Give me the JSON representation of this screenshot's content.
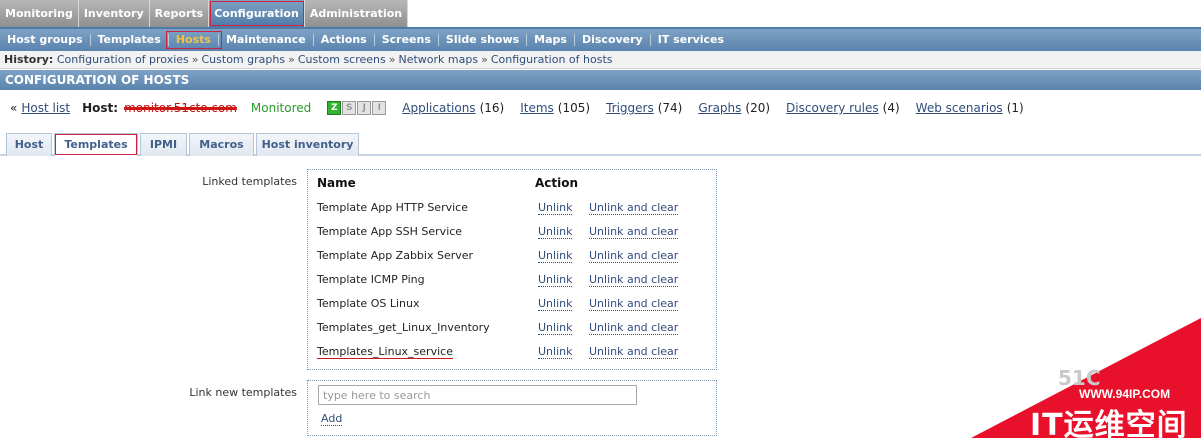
{
  "top_menu": [
    "Monitoring",
    "Inventory",
    "Reports",
    "Configuration",
    "Administration"
  ],
  "sub_menu": [
    "Host groups",
    "Templates",
    "Hosts",
    "Maintenance",
    "Actions",
    "Screens",
    "Slide shows",
    "Maps",
    "Discovery",
    "IT services"
  ],
  "history": {
    "label": "History:",
    "items": [
      "Configuration of proxies",
      "Custom graphs",
      "Custom screens",
      "Network maps",
      "Configuration of hosts"
    ],
    "separator": "»"
  },
  "header": {
    "title": "CONFIGURATION OF HOSTS"
  },
  "host_line": {
    "back_prefix": "«",
    "back_link": "Host list",
    "host_label": "Host:",
    "host_name": "monitor.51cto.com",
    "status": "Monitored",
    "availability": [
      "Z",
      "S",
      "J",
      "I"
    ],
    "links": [
      {
        "label": "Applications",
        "count": "(16)"
      },
      {
        "label": "Items",
        "count": "(105)"
      },
      {
        "label": "Triggers",
        "count": "(74)"
      },
      {
        "label": "Graphs",
        "count": "(20)"
      },
      {
        "label": "Discovery rules",
        "count": "(4)"
      },
      {
        "label": "Web scenarios",
        "count": "(1)"
      }
    ]
  },
  "tabs": [
    "Host",
    "Templates",
    "IPMI",
    "Macros",
    "Host inventory"
  ],
  "linked_templates": {
    "label": "Linked templates",
    "col_name": "Name",
    "col_action": "Action",
    "unlink_label": "Unlink",
    "unlink_clear_label": "Unlink and clear",
    "rows": [
      "Template App HTTP Service",
      "Template App SSH Service",
      "Template App Zabbix Server",
      "Template ICMP Ping",
      "Template OS Linux",
      "Templates_get_Linux_Inventory",
      "Templates_Linux_service"
    ]
  },
  "link_new": {
    "label": "Link new templates",
    "placeholder": "type here to search",
    "add_label": "Add"
  },
  "watermark": {
    "faint": "51C",
    "url": "WWW.94IP.COM",
    "title": "IT运维空间"
  },
  "colors": {
    "menu_blue": "#5a83ad",
    "link": "#2f4d7a",
    "status_green": "#2a9a2a",
    "highlight_red": "#cc2244",
    "watermark_red": "#e8102a"
  }
}
